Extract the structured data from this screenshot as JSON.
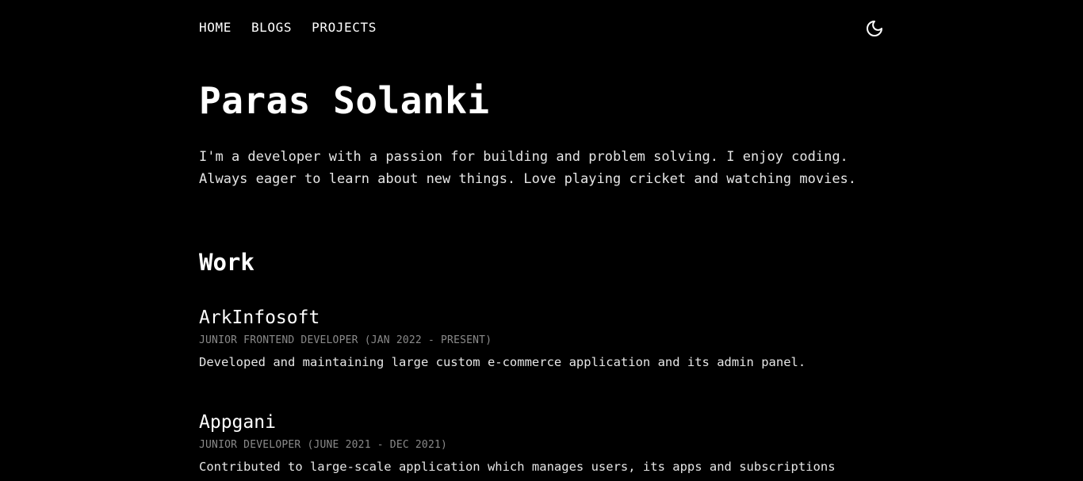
{
  "nav": {
    "links": [
      "HOME",
      "BLOGS",
      "PROJECTS"
    ],
    "theme_icon": "moon-icon"
  },
  "header": {
    "title": "Paras Solanki",
    "intro": "I'm a developer with a passion for building and problem solving. I enjoy coding. Always eager to learn about new things. Love playing cricket and watching movies."
  },
  "work": {
    "title": "Work",
    "jobs": [
      {
        "company": "ArkInfosoft",
        "role": "JUNIOR FRONTEND DEVELOPER (JAN 2022 - PRESENT)",
        "description": "Developed and maintaining large custom e-commerce application and its admin panel."
      },
      {
        "company": "Appgani",
        "role": "JUNIOR DEVELOPER (JUNE 2021 - DEC 2021)",
        "description": "Contributed to large-scale application which manages users, its apps and subscriptions"
      }
    ]
  },
  "colors": {
    "background": "#000000",
    "text": "#ffffff",
    "muted": "#8a8a8a"
  }
}
